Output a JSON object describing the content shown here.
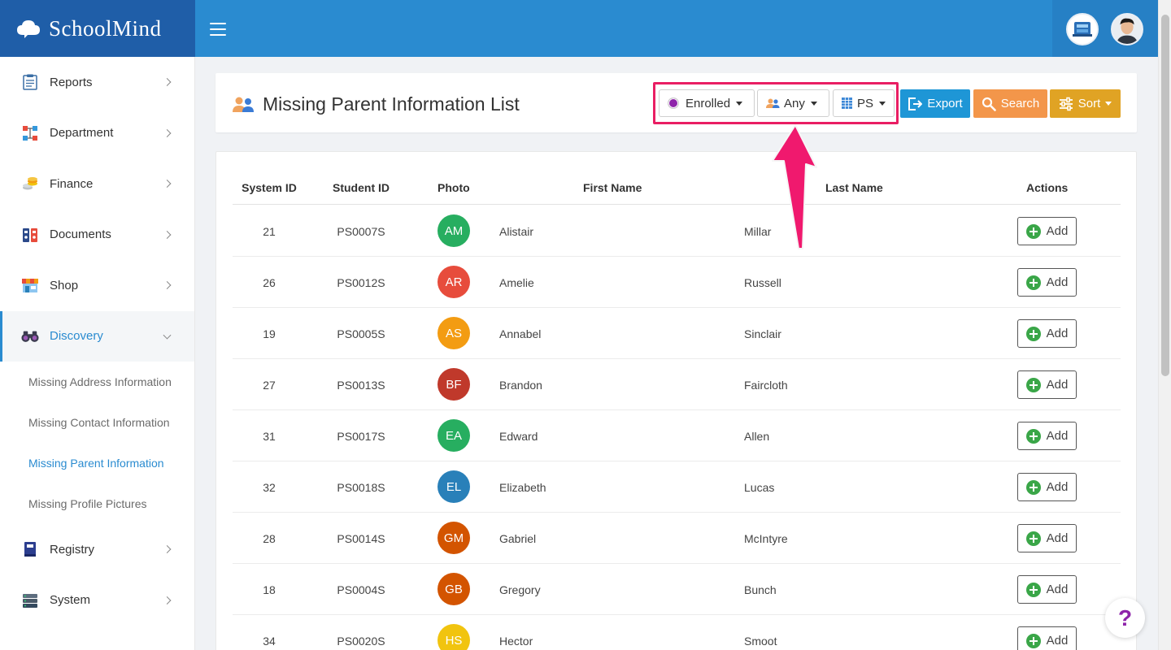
{
  "brand": {
    "name": "SchoolMind"
  },
  "sidebar": {
    "items": [
      {
        "label": "Reports",
        "icon": "clipboard-icon"
      },
      {
        "label": "Department",
        "icon": "sitemap-icon"
      },
      {
        "label": "Finance",
        "icon": "coins-icon"
      },
      {
        "label": "Documents",
        "icon": "binders-icon"
      },
      {
        "label": "Shop",
        "icon": "store-icon"
      },
      {
        "label": "Discovery",
        "icon": "binoculars-icon",
        "active": true
      },
      {
        "label": "Registry",
        "icon": "book-icon"
      },
      {
        "label": "System",
        "icon": "server-icon"
      }
    ],
    "discovery_sub": [
      {
        "label": "Missing Address Information"
      },
      {
        "label": "Missing Contact Information"
      },
      {
        "label": "Missing Parent Information",
        "current": true
      },
      {
        "label": "Missing Profile Pictures"
      }
    ]
  },
  "header": {
    "title": "Missing Parent Information List",
    "filters": {
      "status": "Enrolled",
      "parent": "Any",
      "grade": "PS"
    },
    "buttons": {
      "export": "Export",
      "search": "Search",
      "sort": "Sort"
    }
  },
  "table": {
    "columns": [
      "System ID",
      "Student ID",
      "Photo",
      "First Name",
      "Last Name",
      "Actions"
    ],
    "add_label": "Add",
    "rows": [
      {
        "system_id": "21",
        "student_id": "PS0007S",
        "initials": "AM",
        "color": "#27ae60",
        "first": "Alistair",
        "last": "Millar"
      },
      {
        "system_id": "26",
        "student_id": "PS0012S",
        "initials": "AR",
        "color": "#e74c3c",
        "first": "Amelie",
        "last": "Russell"
      },
      {
        "system_id": "19",
        "student_id": "PS0005S",
        "initials": "AS",
        "color": "#f39c12",
        "first": "Annabel",
        "last": "Sinclair"
      },
      {
        "system_id": "27",
        "student_id": "PS0013S",
        "initials": "BF",
        "color": "#c0392b",
        "first": "Brandon",
        "last": "Faircloth"
      },
      {
        "system_id": "31",
        "student_id": "PS0017S",
        "initials": "EA",
        "color": "#27ae60",
        "first": "Edward",
        "last": "Allen"
      },
      {
        "system_id": "32",
        "student_id": "PS0018S",
        "initials": "EL",
        "color": "#2980b9",
        "first": "Elizabeth",
        "last": "Lucas"
      },
      {
        "system_id": "28",
        "student_id": "PS0014S",
        "initials": "GM",
        "color": "#d35400",
        "first": "Gabriel",
        "last": "McIntyre"
      },
      {
        "system_id": "18",
        "student_id": "PS0004S",
        "initials": "GB",
        "color": "#d35400",
        "first": "Gregory",
        "last": "Bunch"
      },
      {
        "system_id": "34",
        "student_id": "PS0020S",
        "initials": "HS",
        "color": "#f1c40f",
        "first": "Hector",
        "last": "Smoot"
      }
    ]
  },
  "help": {
    "label": "?"
  }
}
